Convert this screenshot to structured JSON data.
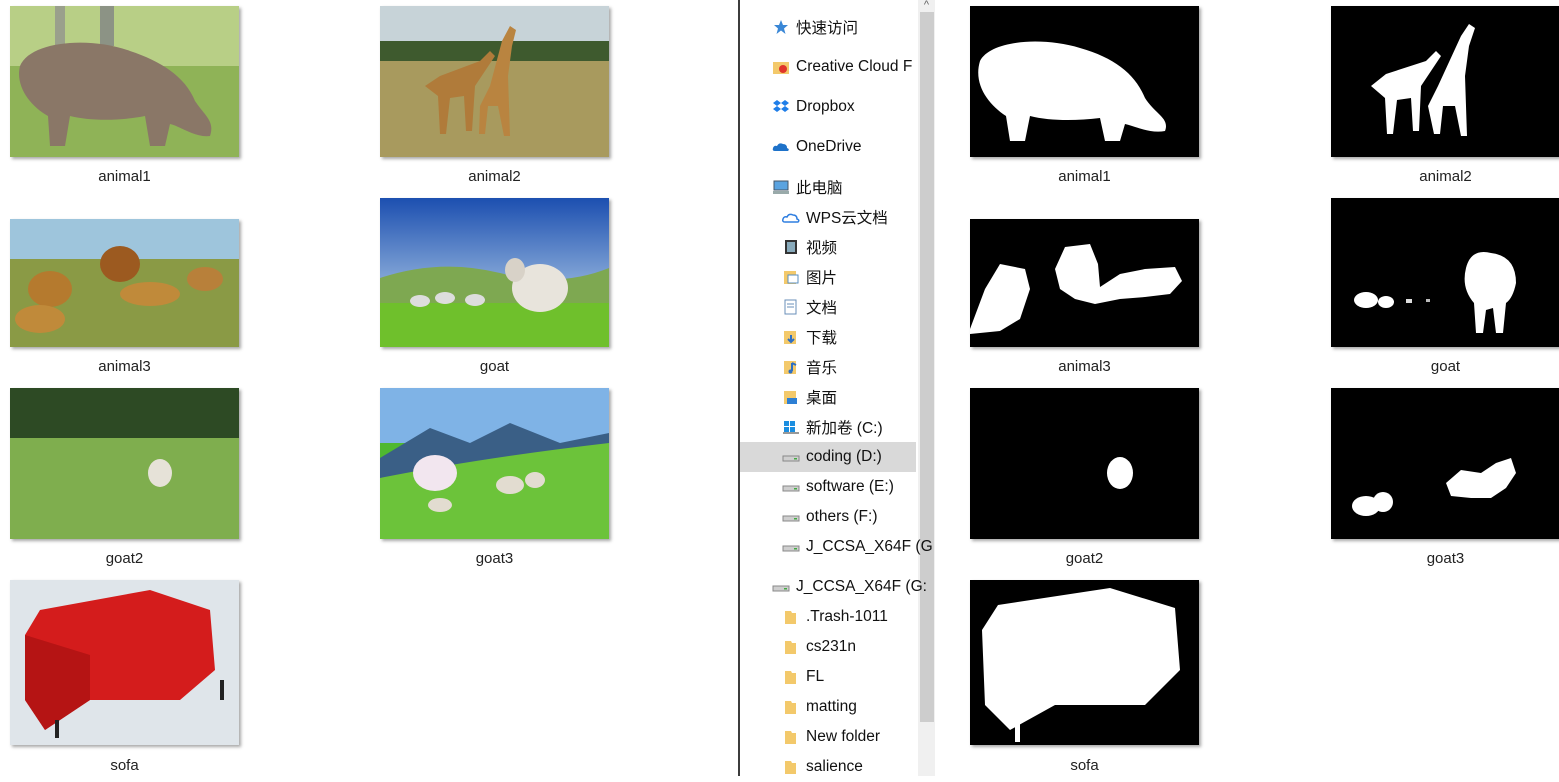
{
  "left_images": [
    {
      "label": "animal1"
    },
    {
      "label": "animal2"
    },
    {
      "label": "animal3"
    },
    {
      "label": "goat"
    },
    {
      "label": "goat2"
    },
    {
      "label": "goat3"
    },
    {
      "label": "sofa"
    }
  ],
  "right_images": [
    {
      "label": "animal1"
    },
    {
      "label": "animal2"
    },
    {
      "label": "animal3"
    },
    {
      "label": "goat"
    },
    {
      "label": "goat2"
    },
    {
      "label": "goat3"
    },
    {
      "label": "sofa"
    }
  ],
  "nav": {
    "items": [
      {
        "label": "快速访问",
        "icon": "star-icon"
      },
      {
        "label": "Creative Cloud F",
        "icon": "creative-cloud-folder-icon"
      },
      {
        "label": "Dropbox",
        "icon": "dropbox-icon"
      },
      {
        "label": "OneDrive",
        "icon": "onedrive-cloud-icon"
      },
      {
        "label": "此电脑",
        "icon": "computer-icon"
      },
      {
        "label": "WPS云文档",
        "icon": "wps-cloud-icon"
      },
      {
        "label": "视频",
        "icon": "video-folder-icon"
      },
      {
        "label": "图片",
        "icon": "pictures-folder-icon"
      },
      {
        "label": "文档",
        "icon": "documents-folder-icon"
      },
      {
        "label": "下载",
        "icon": "downloads-folder-icon"
      },
      {
        "label": "音乐",
        "icon": "music-folder-icon"
      },
      {
        "label": "桌面",
        "icon": "desktop-folder-icon"
      },
      {
        "label": "新加卷 (C:)",
        "icon": "windows-drive-icon"
      },
      {
        "label": "coding (D:)",
        "icon": "drive-icon"
      },
      {
        "label": "software (E:)",
        "icon": "drive-icon"
      },
      {
        "label": "others (F:)",
        "icon": "drive-icon"
      },
      {
        "label": "J_CCSA_X64F (G",
        "icon": "drive-icon"
      },
      {
        "label": "J_CCSA_X64F (G:",
        "icon": "drive-icon"
      },
      {
        "label": ".Trash-1011",
        "icon": "folder-icon"
      },
      {
        "label": "cs231n",
        "icon": "folder-icon"
      },
      {
        "label": "FL",
        "icon": "folder-icon"
      },
      {
        "label": "matting",
        "icon": "folder-icon"
      },
      {
        "label": "New folder",
        "icon": "folder-icon"
      },
      {
        "label": "salience",
        "icon": "folder-icon"
      }
    ],
    "selected": "coding (D:)",
    "scroll_up_glyph": "^"
  }
}
